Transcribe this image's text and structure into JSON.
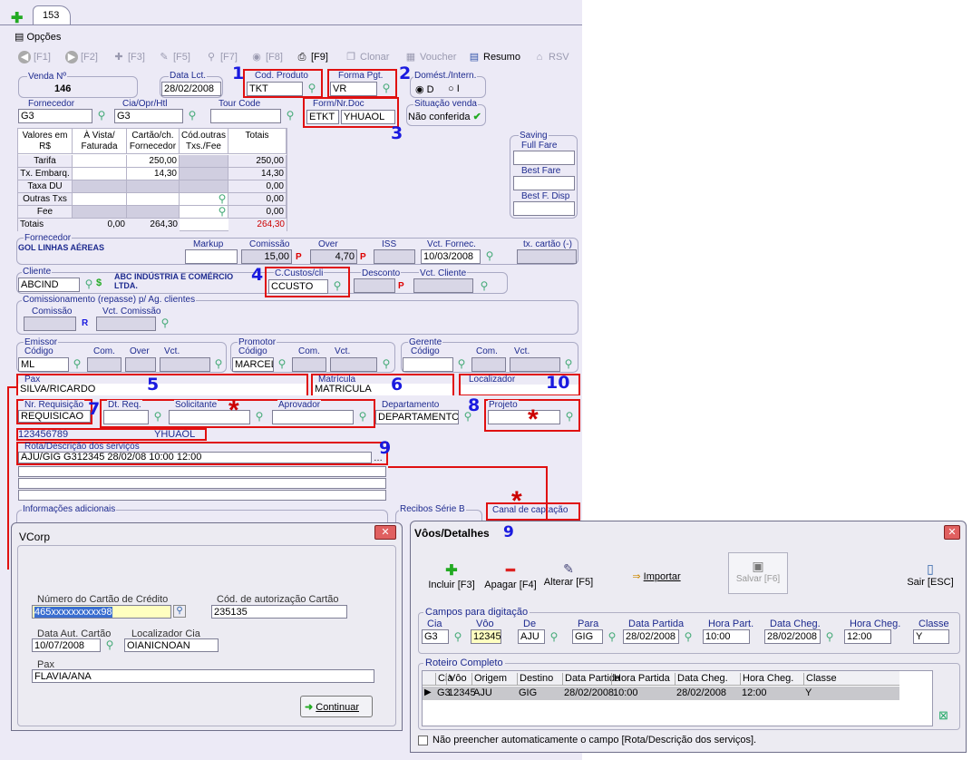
{
  "tab": {
    "label": "153"
  },
  "menu": {
    "options": "Opções"
  },
  "toolbar": {
    "f1": "[F1]",
    "f2": "[F2]",
    "f3": "[F3]",
    "f5": "[F5]",
    "f7": "[F7]",
    "f8": "[F8]",
    "f9": "[F9]",
    "clonar": "Clonar",
    "voucher": "Voucher",
    "resumo": "Resumo",
    "rsv": "RSV"
  },
  "venda": {
    "label": "Venda Nº",
    "value": "146"
  },
  "data_lct": {
    "label": "Data Lct.",
    "value": "28/02/2008"
  },
  "cod_produto": {
    "label": "Cod. Produto",
    "value": "TKT"
  },
  "forma_pgt": {
    "label": "Forma Pgt.",
    "value": "VR"
  },
  "domest": {
    "label": "Domést./Intern.",
    "opt1": "D",
    "opt2": "I"
  },
  "fornecedor": {
    "label": "Fornecedor",
    "value": "G3"
  },
  "cia": {
    "label": "Cia/Opr/Htl",
    "value": "G3"
  },
  "tour": {
    "label": "Tour Code",
    "value": ""
  },
  "form_doc": {
    "label": "Form/Nr.Doc",
    "form": "ETKT",
    "doc": "YHUAOL"
  },
  "situacao": {
    "label": "Situação venda",
    "value": "Não conferida"
  },
  "valores": {
    "headers": [
      "Valores em R$",
      "À Vista/ Faturada",
      "Cartão/ch. Fornecedor",
      "Cód.outras Txs./Fee",
      "Totais"
    ],
    "rows": [
      {
        "name": "Tarifa",
        "vista": "",
        "cartao": "250,00",
        "total": "250,00"
      },
      {
        "name": "Tx. Embarq.",
        "vista": "",
        "cartao": "14,30",
        "total": "14,30"
      },
      {
        "name": "Taxa DU",
        "vista": "",
        "cartao": "",
        "total": "0,00"
      },
      {
        "name": "Outras Txs",
        "vista": "",
        "cartao": "",
        "total": "0,00"
      },
      {
        "name": "Fee",
        "vista": "",
        "cartao": "",
        "total": "0,00"
      }
    ],
    "totais": {
      "name": "Totais",
      "vista": "0,00",
      "cartao": "264,30",
      "total": "264,30"
    }
  },
  "saving": {
    "label": "Saving",
    "full": "Full Fare",
    "best": "Best Fare",
    "bestf": "Best F. Disp"
  },
  "forn2": {
    "label": "Fornecedor",
    "value": "GOL LINHAS AÉREAS",
    "markup": "Markup",
    "comissao": "Comissão",
    "comissao_val": "15,00",
    "over": "Over",
    "over_val": "4,70",
    "iss": "ISS",
    "vct": "Vct. Fornec.",
    "vct_val": "10/03/2008",
    "tx": "tx. cartão (-)",
    "p": "P"
  },
  "cliente": {
    "label": "Cliente",
    "value": "ABCIND",
    "name": "ABC INDÚSTRIA E COMÉRCIO LTDA.",
    "ccustos": "C.Custos/cli",
    "cc_val": "CCUSTO",
    "desconto": "Desconto",
    "vct": "Vct. Cliente"
  },
  "repasse": {
    "label": "Comissionamento (repasse) p/ Ag. clientes",
    "comissao": "Comissão",
    "r": "R",
    "vct": "Vct. Comissão"
  },
  "emissor": {
    "label": "Emissor",
    "codigo": "Código",
    "value": "ML",
    "com": "Com.",
    "over": "Over",
    "vct": "Vct."
  },
  "promotor": {
    "label": "Promotor",
    "codigo": "Código",
    "value": "MARCEL",
    "com": "Com.",
    "vct": "Vct."
  },
  "gerente": {
    "label": "Gerente",
    "codigo": "Código",
    "com": "Com.",
    "vct": "Vct."
  },
  "pax": {
    "label": "Pax",
    "value": "SILVA/RICARDO"
  },
  "matricula": {
    "label": "Matrícula",
    "value": "MATRICULA"
  },
  "localizador": {
    "label": "Localizador"
  },
  "requisicao": {
    "label": "Nr. Requisição",
    "value": "REQUISICAO"
  },
  "dtreq": {
    "label": "Dt. Req."
  },
  "solicitante": {
    "label": "Solicitante"
  },
  "aprovador": {
    "label": "Aprovador"
  },
  "departamento": {
    "label": "Departamento",
    "value": "DEPARTAMENTO"
  },
  "projeto": {
    "label": "Projeto"
  },
  "cartao_line": {
    "left": "123456789",
    "right": "YHUAOL"
  },
  "rota": {
    "label": "Rota/Descrição dos serviços",
    "value": "AJU/GIG G312345 28/02/08 10:00 12:00"
  },
  "info": {
    "label": "Informações adicionais"
  },
  "recibos": {
    "label": "Recibos Série B"
  },
  "canal": {
    "label": "Canal de captação"
  },
  "markers": {
    "n1": "1",
    "n2": "2",
    "n3": "3",
    "n4": "4",
    "n5": "5",
    "n6": "6",
    "n7": "7",
    "n8": "8",
    "n9": "9",
    "n10": "10",
    "star": "*"
  },
  "vcorp": {
    "title": "VCorp",
    "cartao_label": "Número do Cartão de Crédito",
    "cartao_val": "465xxxxxxxxxx98",
    "autorizacao_label": "Cód. de autorização Cartão",
    "autorizacao_val": "235135",
    "data_label": "Data Aut. Cartão",
    "data_val": "10/07/2008",
    "loc_label": "Localizador Cia",
    "loc_val": "OIANICNOAN",
    "pax_label": "Pax",
    "pax_val": "FLAVIA/ANA",
    "continuar": "Continuar"
  },
  "voos": {
    "title": "Vôos/Detalhes",
    "title_num": "9",
    "incluir": "Incluir [F3]",
    "apagar": "Apagar [F4]",
    "alterar": "Alterar [F5]",
    "importar": "Importar",
    "salvar": "Salvar [F6]",
    "sair": "Sair [ESC]",
    "campos": "Campos para digitação",
    "fields": {
      "cia": "Cia",
      "cia_v": "G3",
      "voo": "Vôo",
      "voo_v": "12345",
      "de": "De",
      "de_v": "AJU",
      "para": "Para",
      "para_v": "GIG",
      "dp": "Data Partida",
      "dp_v": "28/02/2008",
      "hp": "Hora Part.",
      "hp_v": "10:00",
      "dc": "Data Cheg.",
      "dc_v": "28/02/2008",
      "hc": "Hora Cheg.",
      "hc_v": "12:00",
      "cl": "Classe",
      "cl_v": "Y"
    },
    "roteiro": "Roteiro Completo",
    "cols": [
      "Cia",
      "Vôo",
      "Origem",
      "Destino",
      "Data Partida",
      "Hora Partida",
      "Data Cheg.",
      "Hora Cheg.",
      "Classe"
    ],
    "row": [
      "G3",
      "12345",
      "AJU",
      "GIG",
      "28/02/2008",
      "10:00",
      "28/02/2008",
      "12:00",
      "Y"
    ],
    "check": "Não preencher automaticamente o campo [Rota/Descrição dos serviços]."
  }
}
